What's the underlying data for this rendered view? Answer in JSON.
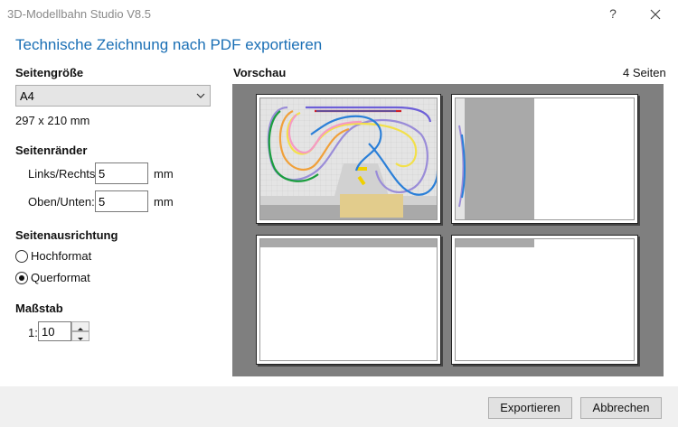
{
  "window": {
    "title": "3D-Modellbahn Studio V8.5",
    "help_glyph": "?"
  },
  "dialog": {
    "heading": "Technische Zeichnung nach PDF exportieren"
  },
  "page_size": {
    "label": "Seitengröße",
    "selected": "A4",
    "dimensions": "297 x 210 mm"
  },
  "margins": {
    "label": "Seitenränder",
    "left_right_label": "Links/Rechts:",
    "left_right_value": "5",
    "top_bottom_label": "Oben/Unten:",
    "top_bottom_value": "5",
    "unit": "mm"
  },
  "orientation": {
    "label": "Seitenausrichtung",
    "options": [
      {
        "label": "Hochformat",
        "selected": false
      },
      {
        "label": "Querformat",
        "selected": true
      }
    ]
  },
  "scale": {
    "label": "Maßstab",
    "prefix": "1:",
    "value": "10"
  },
  "preview": {
    "label": "Vorschau",
    "page_count": "4 Seiten"
  },
  "buttons": {
    "export": "Exportieren",
    "cancel": "Abbrechen"
  },
  "colors": {
    "heading": "#1a6fb5",
    "preview_bg": "#7f7f7f"
  }
}
